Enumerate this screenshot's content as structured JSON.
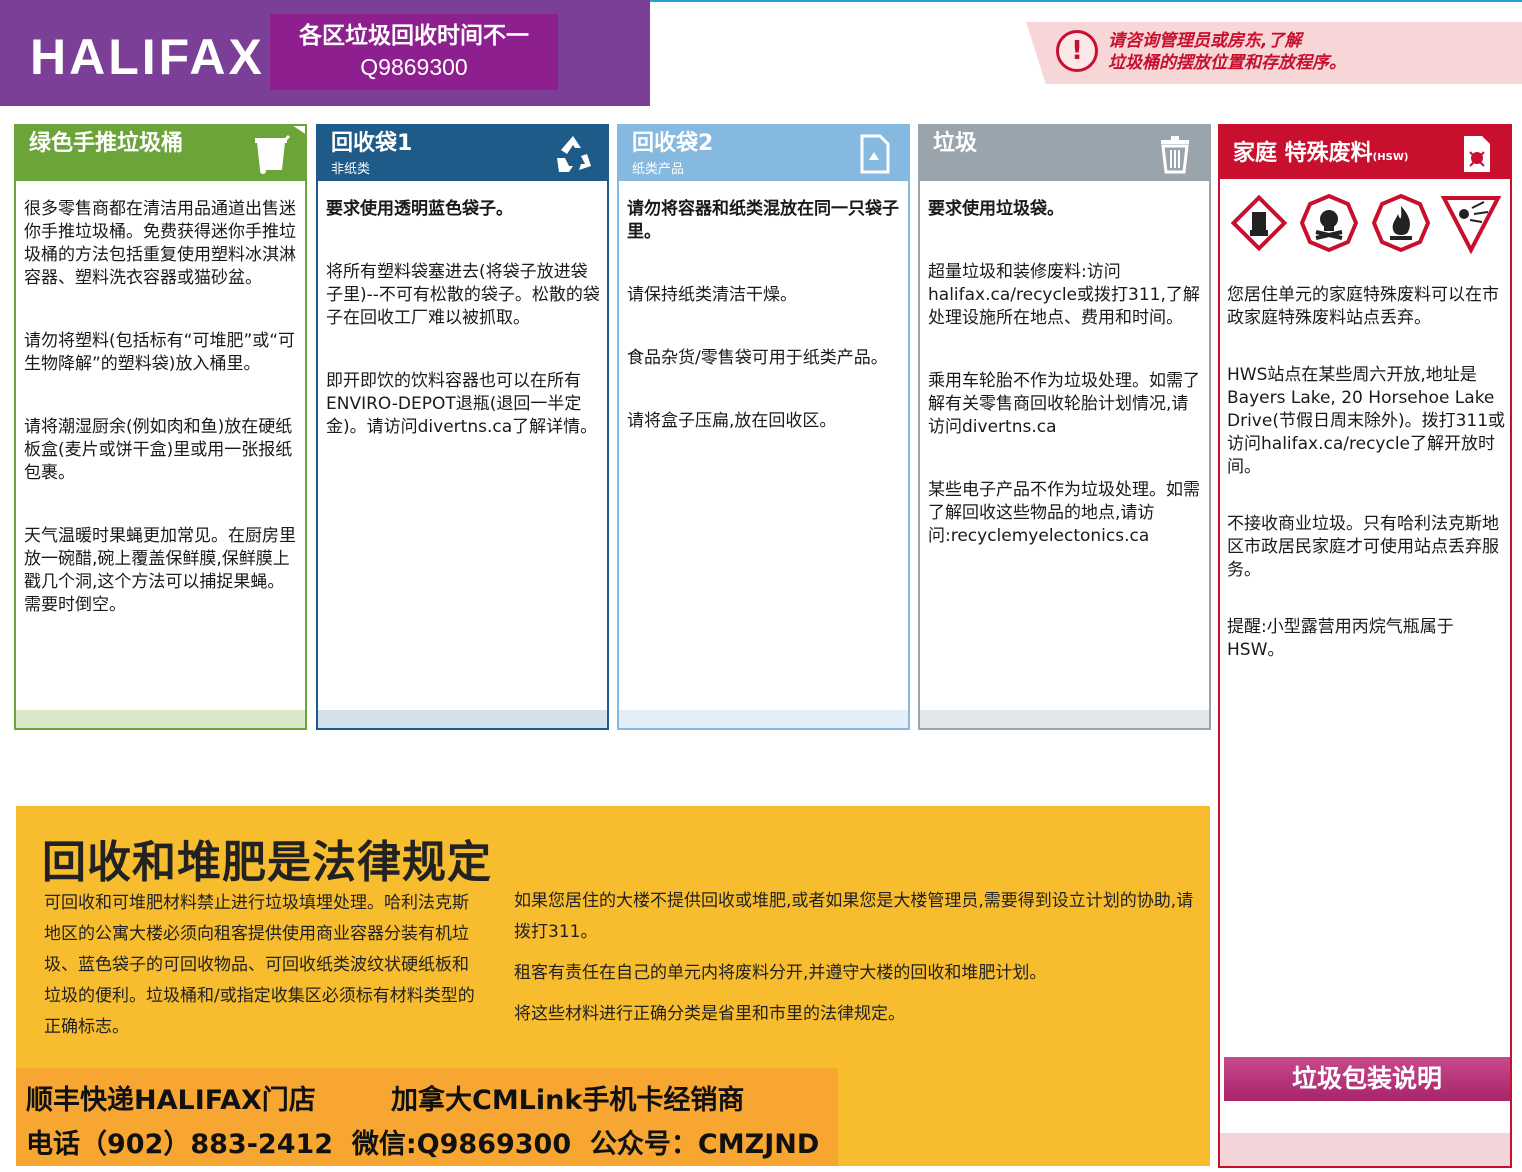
{
  "header": {
    "logo": "HALIFAX",
    "promo_line1": "各区垃圾回收时间不一",
    "promo_line2": "Q9869300",
    "notice_icon": "!",
    "notice_line1": "请咨询管理员或房东,了解",
    "notice_line2": "垃圾桶的摆放位置和存放程序。"
  },
  "columns": {
    "green": {
      "title": "绿色手推垃圾桶",
      "icon": "green-cart-icon",
      "paragraphs": [
        "很多零售商都在清洁用品通道出售迷你手推垃圾桶。免费获得迷你手推垃圾桶的方法包括重复使用塑料冰淇淋容器、塑料洗衣容器或猫砂盆。",
        "请勿将塑料(包括标有“可堆肥”或“可生物降解”的塑料袋)放入桶里。",
        "请将潮湿厨余(例如肉和鱼)放在硬纸板盒(麦片或饼干盒)里或用一张报纸包裹。",
        "天气温暖时果蝇更加常见。在厨房里放一碗醋,碗上覆盖保鲜膜,保鲜膜上戳几个洞,这个方法可以捕捉果蝇。需要时倒空。"
      ]
    },
    "blue1": {
      "title": "回收袋1",
      "subtitle": "非纸类",
      "icon": "recycle-icon",
      "paragraphs": [
        "要求使用透明蓝色袋子。",
        "将所有塑料袋塞进去(将袋子放进袋子里)--不可有松散的袋子。松散的袋子在回收工厂难以被抓取。",
        "即开即饮的饮料容器也可以在所有ENVIRO-DEPOT退瓶(退回一半定金)。请访问divertns.ca了解详情。"
      ]
    },
    "blue2": {
      "title": "回收袋2",
      "subtitle": "纸类产品",
      "icon": "paper-recycle-icon",
      "paragraphs": [
        "请勿将容器和纸类混放在同一只袋子里。",
        "请保持纸类清洁干燥。",
        "食品杂货/零售袋可用于纸类产品。",
        "请将盒子压扁,放在回收区。"
      ]
    },
    "garbage": {
      "title": "垃圾",
      "icon": "trash-bin-icon",
      "paragraphs": [
        "要求使用垃圾袋。",
        "超量垃圾和装修废料:访问halifax.ca/recycle或拨打311,了解处理设施所在地点、费用和时间。",
        "乘用车轮胎不作为垃圾处理。如需了解有关零售商回收轮胎计划情况,请访问divertns.ca",
        "某些电子产品不作为垃圾处理。如需了解回收这些物品的地点,请访问:recyclemyelectonics.ca"
      ]
    },
    "hsw": {
      "title": "家庭 特殊废料",
      "title_small": "(HSW)",
      "icon": "hazard-bin-icon",
      "hazard_icons": [
        "corrosive-icon",
        "toxic-icon",
        "flammable-icon",
        "explosive-icon"
      ],
      "paragraphs": [
        "您居住单元的家庭特殊废料可以在市政家庭特殊废料站点丢弃。",
        "HWS站点在某些周六开放,地址是Bayers Lake, 20 Horsehoe Lake Drive(节假日周末除外)。拨打311或访问halifax.ca/recycle了解开放时间。",
        "不接收商业垃圾。只有哈利法克斯地区市政居民家庭才可使用站点丢弃服务。",
        "提醒:小型露营用丙烷气瓶属于HSW。"
      ],
      "button_label": "垃圾包装说明"
    }
  },
  "law": {
    "title": "回收和堆肥是法律规定",
    "left_text": "可回收和可堆肥材料禁止进行垃圾填埋处理。哈利法克斯地区的公寓大楼必须向租客提供使用商业容器分装有机垃圾、蓝色袋子的可回收物品、可回收纸类波纹状硬纸板和垃圾的便利。垃圾桶和/或指定收集区必须标有材料类型的正确标志。",
    "right_paragraphs": [
      "如果您居住的大楼不提供回收或堆肥,或者如果您是大楼管理员,需要得到设立计划的协助,请拨打311。",
      "租客有责任在自己的单元内将废料分开,并遵守大楼的回收和堆肥计划。",
      "将这些材料进行正确分类是省里和市里的法律规定。"
    ]
  },
  "ad": {
    "line1": "顺丰快递HALIFAX门店        加拿大CMLink手机卡经销商",
    "line2": "电话（902）883-2412  微信:Q9869300  公众号：CMZJND"
  },
  "colors": {
    "purple": "#7b3f98",
    "green": "#6ba539",
    "blue": "#1e5b88",
    "light_blue": "#85b9df",
    "gray": "#9aa4ad",
    "red": "#c8102e",
    "yellow": "#f7bd2e",
    "orange": "#f7a632"
  }
}
